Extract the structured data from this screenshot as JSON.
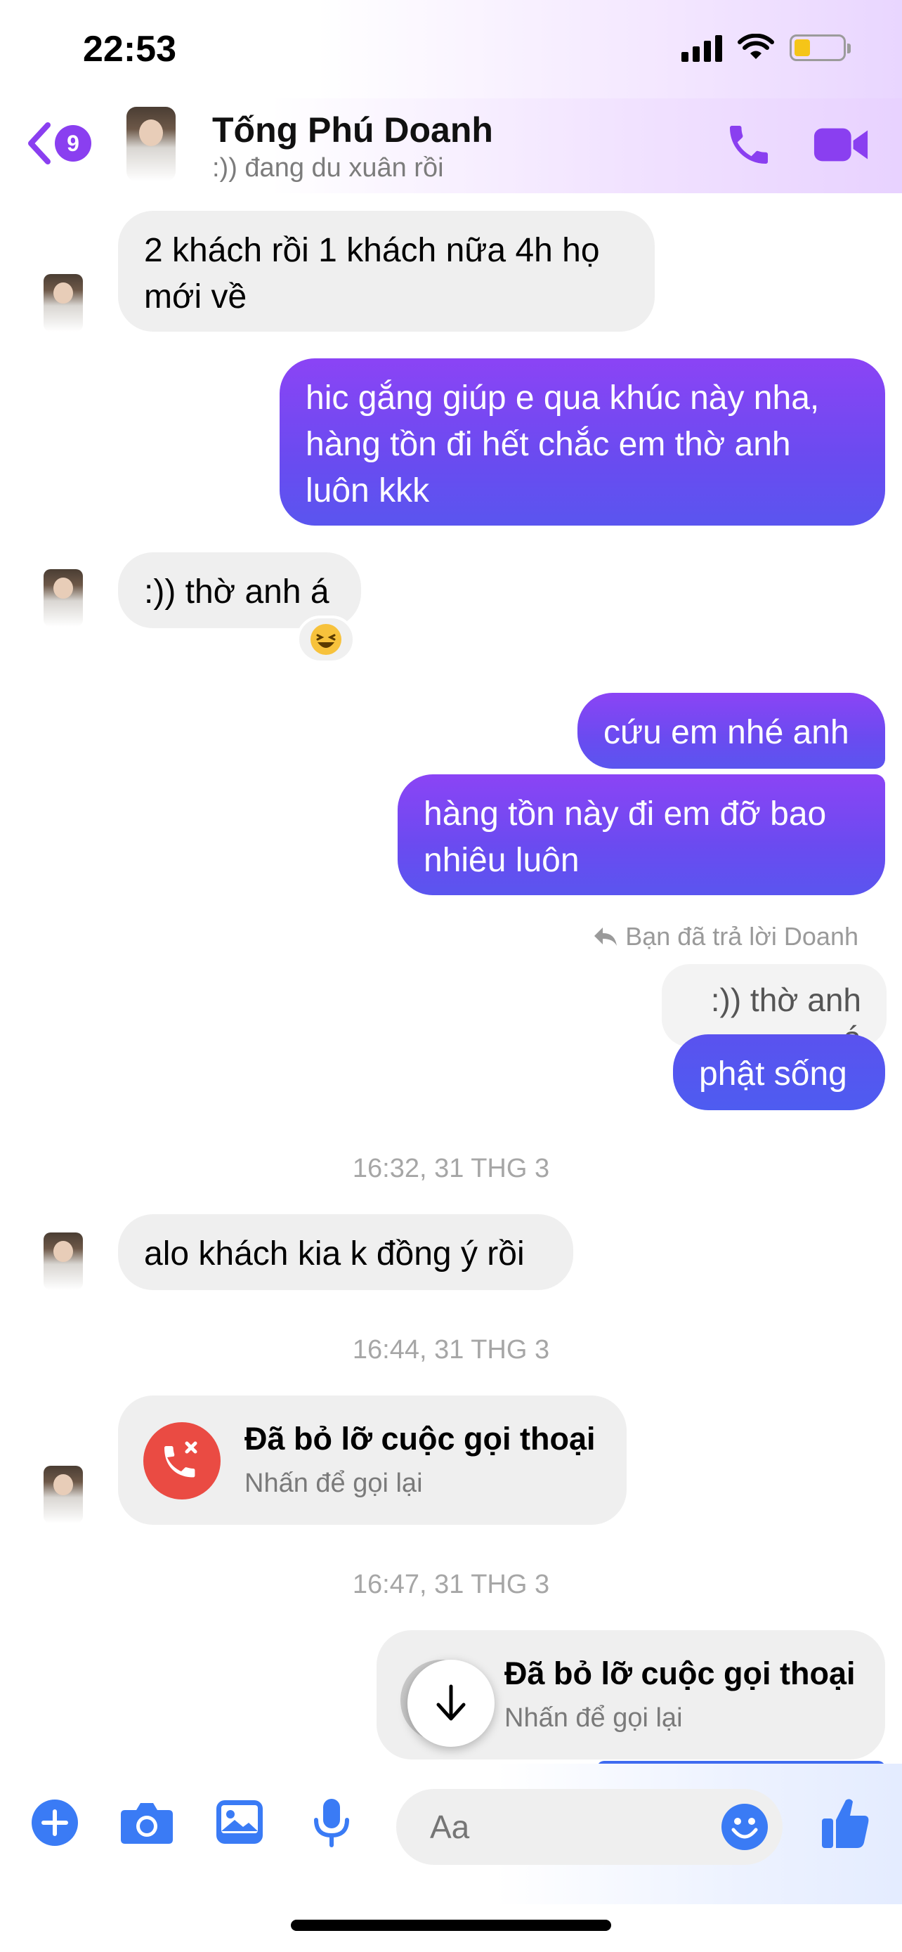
{
  "status_bar": {
    "time": "22:53"
  },
  "header": {
    "back_badge": "9",
    "contact_name": "Tống Phú Doanh",
    "contact_status": ":)) đang du xuân rồi"
  },
  "messages": [
    {
      "dir": "in",
      "text": "2 khách rồi 1 khách nữa 4h họ mới về"
    },
    {
      "dir": "out",
      "text": "hic gắng giúp e qua khúc này nha, hàng tồn đi hết chắc em thờ anh luôn kkk"
    },
    {
      "dir": "in",
      "text": ":)) thờ anh á",
      "reaction": "😆"
    },
    {
      "dir": "out",
      "text": "cứu em nhé anh"
    },
    {
      "dir": "out",
      "text": "hàng tồn này đi em đỡ bao nhiêu luôn"
    },
    {
      "dir": "out",
      "text": "phật sống",
      "reply_note": "Bạn đã trả lời Doanh",
      "quoted": ":)) thờ anh á"
    },
    {
      "dir": "in",
      "text": "alo khách kia k đồng ý rồi"
    }
  ],
  "timestamps": [
    "16:32, 31 THG 3",
    "16:44, 31 THG 3",
    "16:47, 31 THG 3"
  ],
  "calls": [
    {
      "title": "Đã bỏ lỡ cuộc gọi thoại",
      "subtitle": "Nhấn để gọi lại"
    },
    {
      "title": "Đã bỏ lỡ cuộc gọi thoại",
      "subtitle": "Nhấn để gọi lại"
    }
  ],
  "composer": {
    "placeholder": "Aa"
  },
  "colors": {
    "accent_purple": "#8a3ff0",
    "messenger_blue": "#3a7bf5",
    "missed_call_red": "#ea4b43"
  },
  "icons": [
    "back-chevron-icon",
    "phone-icon",
    "video-camera-icon",
    "plus-icon",
    "camera-icon",
    "gallery-icon",
    "microphone-icon",
    "emoji-icon",
    "thumbs-up-icon",
    "missed-call-icon",
    "scroll-down-arrow-icon",
    "reply-arrow-icon"
  ]
}
